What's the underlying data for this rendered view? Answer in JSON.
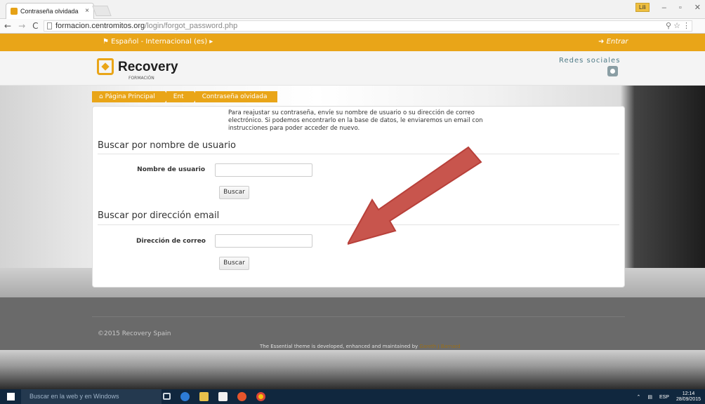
{
  "browser": {
    "tab_title": "Contraseña olvidada",
    "tab_close": "×",
    "url_host": "formacion.centromitos.org",
    "url_path": "/login/forgot_password.php",
    "user_badge": "Lili"
  },
  "site": {
    "language_label": "Español - Internacional (es)",
    "login_link": "Entrar",
    "logo_name": "Recovery",
    "logo_sub": "FORMACIÓN",
    "social_label": "Redes sociales"
  },
  "breadcrumb": {
    "home": "Página Principal",
    "second": "Ent",
    "current": "Contraseña olvidada"
  },
  "form": {
    "intro": "Para reajustar su contraseña, envíe su nombre de usuario o su dirección de correo electrónico. Si podemos encontrarlo en la base de datos, le enviaremos un email con instrucciones para poder acceder de nuevo.",
    "section_username": "Buscar por nombre de usuario",
    "label_username": "Nombre de usuario",
    "username_value": "",
    "button_search_1": "Buscar",
    "section_email": "Buscar por dirección email",
    "label_email": "Dirección de correo",
    "email_value": "",
    "button_search_2": "Buscar"
  },
  "footer": {
    "copyright": "©2015 Recovery Spain",
    "credits_text": "The Essential theme is developed, enhanced and maintained by",
    "credits_name": "Gareth J Barnard"
  },
  "taskbar": {
    "search_placeholder": "Buscar en la web y en Windows",
    "lang": "ESP",
    "time": "12:14",
    "date": "28/09/2015"
  },
  "colors": {
    "accent": "#e9a518",
    "arrow": "#c8554d"
  }
}
